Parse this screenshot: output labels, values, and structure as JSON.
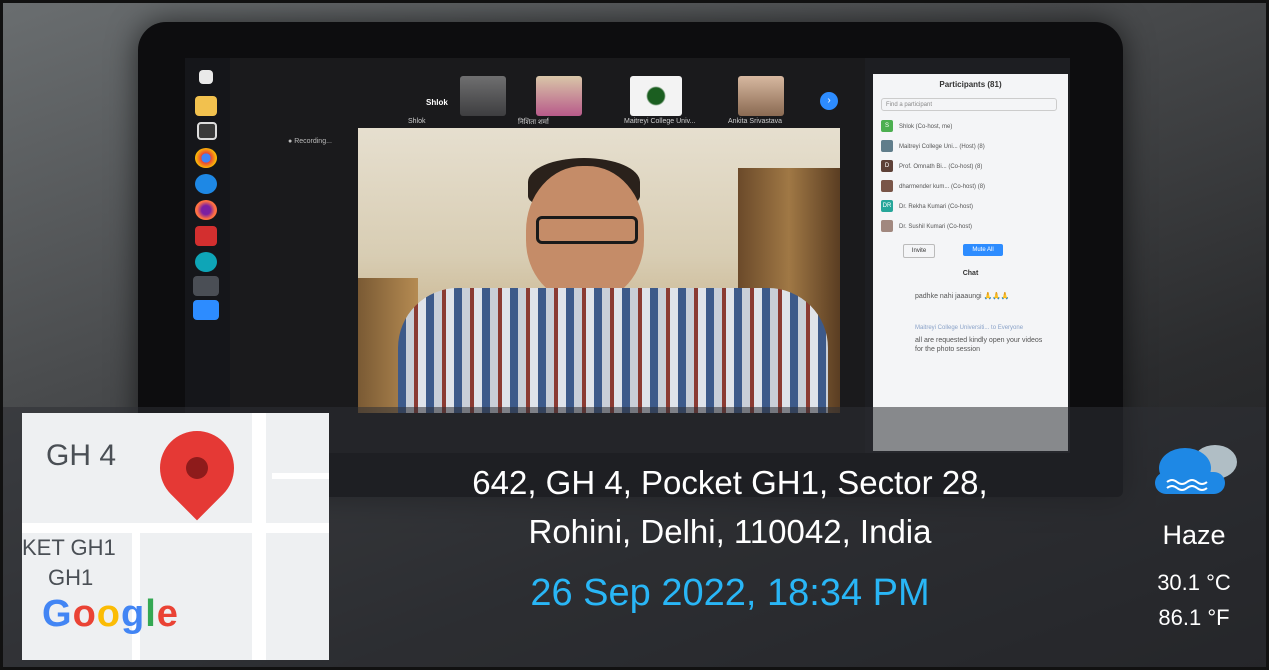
{
  "zoom": {
    "speaker_strip_name": "Shlok",
    "thumbnails": [
      {
        "label": "Shlok"
      },
      {
        "label": "निशिता शर्मा"
      },
      {
        "label": "Maitreyi College Univ..."
      },
      {
        "label": "Ankita Srivastava"
      }
    ],
    "recording_label": "Recording...",
    "participants_title": "Participants (81)",
    "search_placeholder": "Find a participant",
    "participants": [
      {
        "initial": "S",
        "name": "Shlok (Co-host, me)",
        "color": "#4caf50"
      },
      {
        "initial": "",
        "name": "Maitreyi College Uni... (Host) (8)",
        "color": "#607d8b"
      },
      {
        "initial": "D",
        "name": "Prof. Omnath Bi... (Co-host) (8)",
        "color": "#5d4037"
      },
      {
        "initial": "",
        "name": "dharmender kum... (Co-host) (8)",
        "color": "#795548"
      },
      {
        "initial": "DR",
        "name": "Dr. Rekha Kumari (Co-host)",
        "color": "#26a69a"
      },
      {
        "initial": "",
        "name": "Dr. Sushil Kumari (Co-host)",
        "color": "#a1887f"
      }
    ],
    "invite_label": "Invite",
    "mute_all_label": "Mute All",
    "chat_title": "Chat",
    "chat_messages": [
      "padhke nahi jaaaungi 🙏🙏🙏",
      "all are requested kindly open your videos for the photo session"
    ],
    "chat_sender": "Maitreyi College Universiti... to Everyone"
  },
  "map": {
    "labels": [
      "GH 4",
      "KET GH1",
      "GH1"
    ],
    "brand": "Google"
  },
  "stamp": {
    "address_line1": "642, GH 4, Pocket GH1, Sector 28,",
    "address_line2": "Rohini, Delhi, 110042, India",
    "datetime": "26 Sep 2022, 18:34 PM",
    "condition": "Haze",
    "temp_c": "30.1 °C",
    "temp_f": "86.1 °F",
    "datetime_color": "#29b6f6"
  }
}
